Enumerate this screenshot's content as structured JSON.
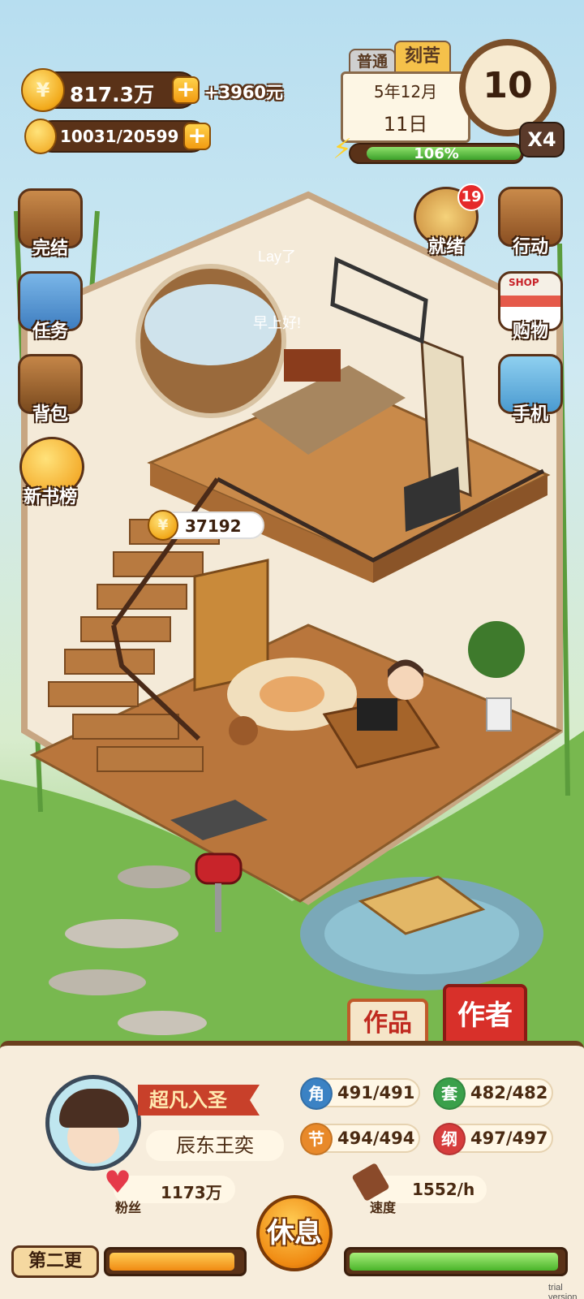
{
  "hud": {
    "coins": "817.3万",
    "coin_bonus": "+3960元",
    "energy": "10031/20599",
    "mode_tab_normal": "普通",
    "mode_tab_hard": "刻苦",
    "date_ym": "5年12月",
    "date_d": "11日",
    "progress_label": "106%",
    "progress_value": 1.06,
    "clock_value": "10",
    "speed_multiplier": "X4"
  },
  "left_menu": [
    {
      "label": "完结",
      "icon": "book-icon"
    },
    {
      "label": "任务",
      "icon": "checklist-icon"
    },
    {
      "label": "背包",
      "icon": "backpack-icon"
    },
    {
      "label": "新书榜",
      "icon": "ranking-medal-icon"
    }
  ],
  "right_menu": {
    "ready_label": "就绪",
    "ready_badge": "19",
    "action_label": "行动",
    "shop_sign": "SHOP",
    "shop_label": "购物",
    "phone_label": "手机"
  },
  "scene": {
    "float_text_1": "Lay了",
    "float_text_2": "早上好!",
    "coin_bubble": "37192",
    "tab_works": "作品",
    "tab_author": "作者"
  },
  "profile": {
    "rank_title": "超凡入圣",
    "name": "辰东王奕",
    "fans_label": "粉丝",
    "fans_value": "1173万",
    "speed_label": "速度",
    "speed_value": "1552/h",
    "stats": [
      {
        "icon": "角",
        "value": "491/491",
        "color": "#3b82c4"
      },
      {
        "icon": "套",
        "value": "482/482",
        "color": "#3aa04a"
      },
      {
        "icon": "节",
        "value": "494/494",
        "color": "#e8892a"
      },
      {
        "icon": "纲",
        "value": "497/497",
        "color": "#d63c3c"
      }
    ]
  },
  "footer": {
    "chapter_label": "第二更",
    "rest_button": "休息",
    "left_bar_value": 0.95,
    "right_bar_value": 0.98,
    "watermark": "trial version"
  }
}
